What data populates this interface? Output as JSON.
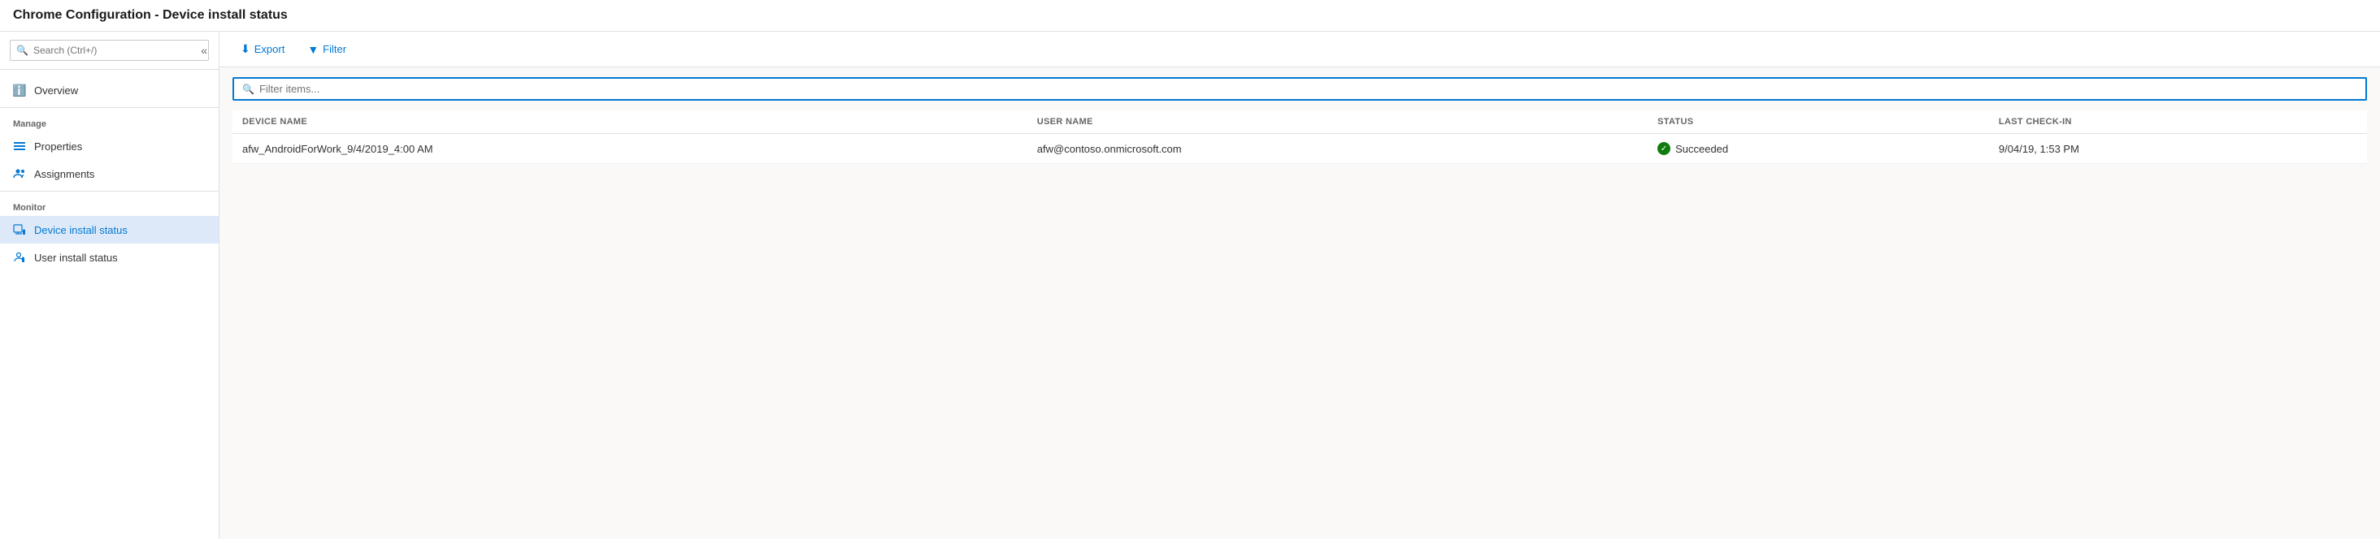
{
  "title": "Chrome Configuration - Device install status",
  "sidebar": {
    "search_placeholder": "Search (Ctrl+/)",
    "collapse_icon": "«",
    "items": [
      {
        "id": "overview",
        "label": "Overview",
        "icon": "ℹ",
        "active": false,
        "section": null
      }
    ],
    "sections": [
      {
        "label": "Manage",
        "items": [
          {
            "id": "properties",
            "label": "Properties",
            "icon": "≡",
            "active": false
          },
          {
            "id": "assignments",
            "label": "Assignments",
            "icon": "👥",
            "active": false
          }
        ]
      },
      {
        "label": "Monitor",
        "items": [
          {
            "id": "device-install-status",
            "label": "Device install status",
            "icon": "📋",
            "active": true
          },
          {
            "id": "user-install-status",
            "label": "User install status",
            "icon": "👤",
            "active": false
          }
        ]
      }
    ]
  },
  "toolbar": {
    "export_label": "Export",
    "filter_label": "Filter",
    "export_icon": "⬇",
    "filter_icon": "▼"
  },
  "table": {
    "filter_placeholder": "Filter items...",
    "columns": [
      {
        "id": "device_name",
        "label": "DEVICE NAME"
      },
      {
        "id": "user_name",
        "label": "USER NAME"
      },
      {
        "id": "status",
        "label": "STATUS"
      },
      {
        "id": "last_checkin",
        "label": "LAST CHECK-IN"
      }
    ],
    "rows": [
      {
        "device_name": "afw_AndroidForWork_9/4/2019_4:00 AM",
        "user_name": "afw@contoso.onmicrosoft.com",
        "status": "Succeeded",
        "status_type": "success",
        "last_checkin": "9/04/19, 1:53 PM"
      }
    ]
  }
}
